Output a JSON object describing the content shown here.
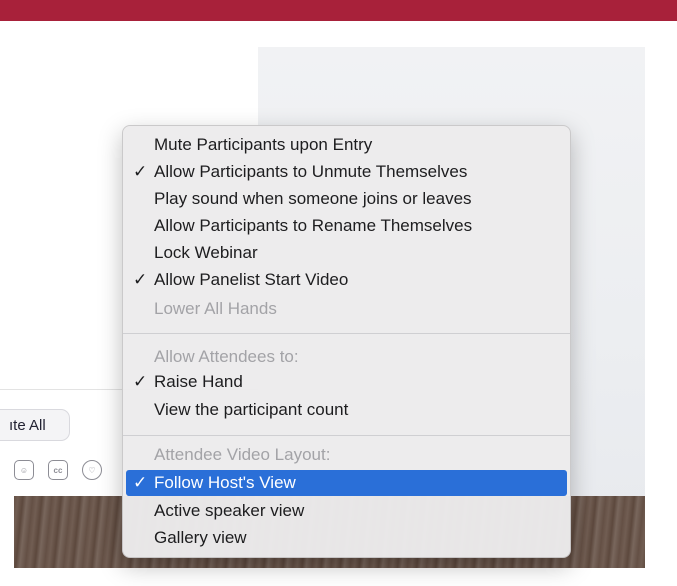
{
  "background_panel": {
    "mute_all_label": "ıte All"
  },
  "toolbar_icons": [
    "face-icon",
    "cc-icon",
    "reaction-icon"
  ],
  "menu": {
    "items": [
      {
        "label": "Mute Participants upon Entry",
        "checked": false
      },
      {
        "label": "Allow Participants to Unmute Themselves",
        "checked": true
      },
      {
        "label": "Play sound when someone joins or leaves",
        "checked": false
      },
      {
        "label": "Allow Participants to Rename Themselves",
        "checked": false
      },
      {
        "label": "Lock Webinar",
        "checked": false
      },
      {
        "label": "Allow Panelist Start Video",
        "checked": true
      },
      {
        "label": "Lower All Hands",
        "checked": false,
        "disabled": true
      }
    ],
    "attendees_header": "Allow Attendees to:",
    "attendee_items": [
      {
        "label": "Raise Hand",
        "checked": true
      },
      {
        "label": "View the participant count",
        "checked": false
      }
    ],
    "layout_header": "Attendee Video Layout:",
    "layout_items": [
      {
        "label": "Follow Host's View",
        "checked": true,
        "selected": true
      },
      {
        "label": "Active speaker view",
        "checked": false
      },
      {
        "label": "Gallery view",
        "checked": false
      }
    ],
    "check_glyph": "✓"
  },
  "colors": {
    "accent_bar": "#a8213a",
    "selection": "#2a6fd8"
  }
}
